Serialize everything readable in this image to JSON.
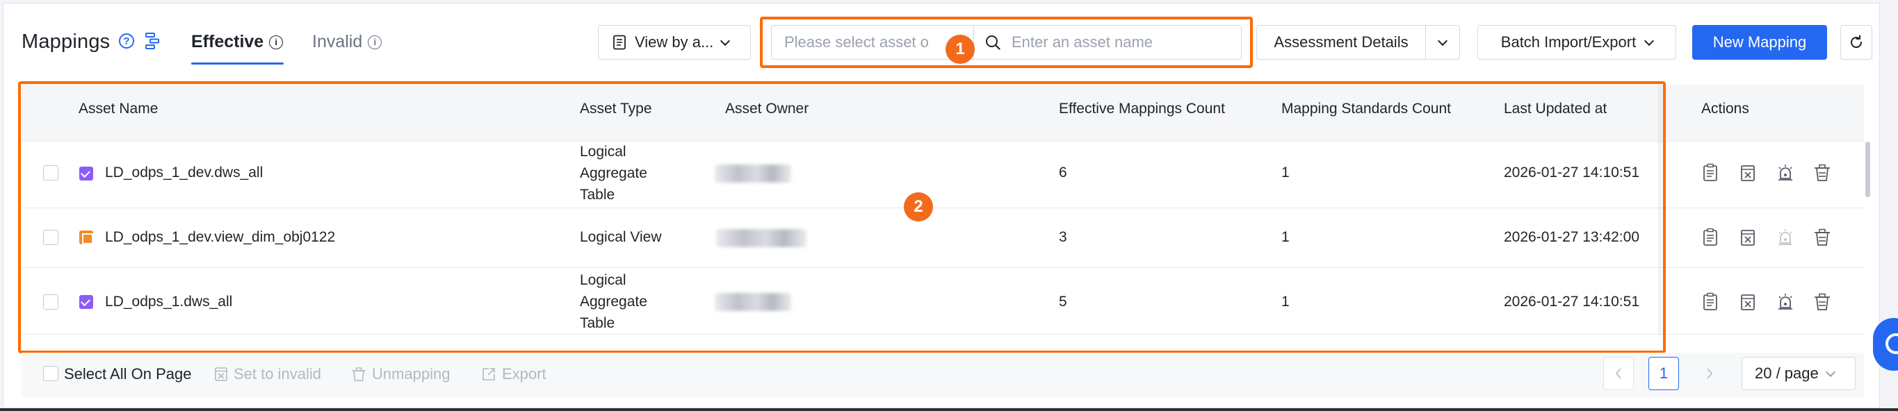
{
  "header": {
    "title": "Mappings",
    "tabs": [
      {
        "label": "Effective",
        "active": true
      },
      {
        "label": "Invalid",
        "active": false
      }
    ],
    "view_by_label": "View by a...",
    "asset_select_placeholder": "Please select asset o",
    "search_placeholder": "Enter an asset name",
    "assessment_label": "Assessment Details",
    "batch_label": "Batch Import/Export",
    "new_mapping_label": "New Mapping"
  },
  "annotations": {
    "marker1": "1",
    "marker2": "2"
  },
  "table": {
    "columns": [
      "Asset Name",
      "Asset Type",
      "Asset Owner",
      "Effective Mappings Count",
      "Mapping Standards Count",
      "Last Updated at",
      "Actions"
    ],
    "rows": [
      {
        "name": "LD_odps_1_dev.dws_all",
        "type_lines": [
          "Logical",
          "Aggregate",
          "Table"
        ],
        "type_icon": "logical-table-icon",
        "effective_count": "6",
        "standards_count": "1",
        "updated": "2026-01-27 14:10:51"
      },
      {
        "name": "LD_odps_1_dev.view_dim_obj0122",
        "type_lines": [
          "Logical View"
        ],
        "type_icon": "logical-view-icon",
        "effective_count": "3",
        "standards_count": "1",
        "updated": "2026-01-27 13:42:00"
      },
      {
        "name": "LD_odps_1.dws_all",
        "type_lines": [
          "Logical",
          "Aggregate",
          "Table"
        ],
        "type_icon": "logical-table-icon",
        "effective_count": "5",
        "standards_count": "1",
        "updated": "2026-01-27 14:10:51"
      }
    ]
  },
  "footer": {
    "select_all_label": "Select All On Page",
    "set_invalid_label": "Set to invalid",
    "unmapping_label": "Unmapping",
    "export_label": "Export",
    "current_page": "1",
    "page_size": "20 / page"
  },
  "colors": {
    "accent": "#2468f2",
    "highlight": "#ff6a00"
  }
}
